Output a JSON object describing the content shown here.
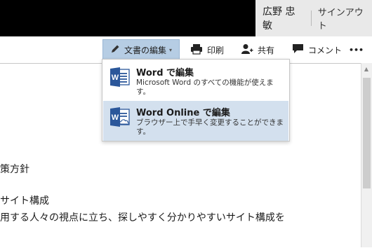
{
  "header": {
    "user_name": "広野 忠敏",
    "signout_label": "サインアウト"
  },
  "toolbar": {
    "edit_label": "文書の編集",
    "print_label": "印刷",
    "share_label": "共有",
    "comment_label": "コメント",
    "more_label": "•••"
  },
  "menu": {
    "items": [
      {
        "title": "Word で編集",
        "description": "Microsoft Word のすべての機能が使えます。"
      },
      {
        "title": "Word Online で編集",
        "description": "ブラウザー上で手早く変更することができます。"
      }
    ]
  },
  "document": {
    "lines": [
      "策方針",
      "サイト構成",
      "用する人々の視点に立ち、探しやすく分かりやすいサイト構成を"
    ]
  },
  "colors": {
    "accent": "#2b579a",
    "selected": "#d3e0ee",
    "edit_button": "#b6cde4"
  }
}
